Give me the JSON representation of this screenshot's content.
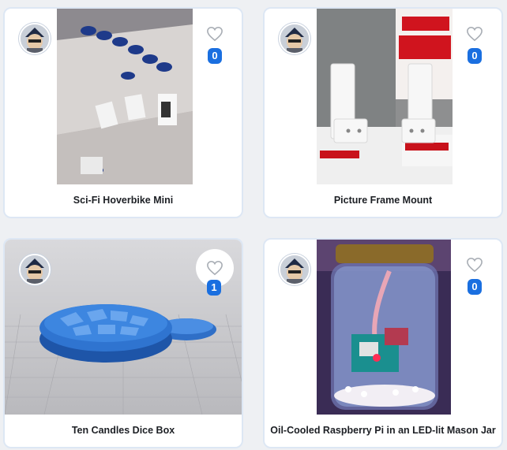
{
  "colors": {
    "accent": "#1a6fe0",
    "card_border": "#dde7f4",
    "background": "#eef0f3"
  },
  "cards": [
    {
      "title": "Sci-Fi Hoverbike Mini",
      "likes": "0",
      "avatar_icon": "user-avatar-icon",
      "like_icon": "heart-outline-icon"
    },
    {
      "title": "Picture Frame Mount",
      "likes": "0",
      "avatar_icon": "user-avatar-icon",
      "like_icon": "heart-outline-icon"
    },
    {
      "title": "Ten Candles Dice Box",
      "likes": "1",
      "avatar_icon": "user-avatar-icon",
      "like_icon": "heart-outline-icon"
    },
    {
      "title": "Oil-Cooled Raspberry Pi in an LED-lit Mason Jar",
      "likes": "0",
      "avatar_icon": "user-avatar-icon",
      "like_icon": "heart-outline-icon"
    }
  ]
}
